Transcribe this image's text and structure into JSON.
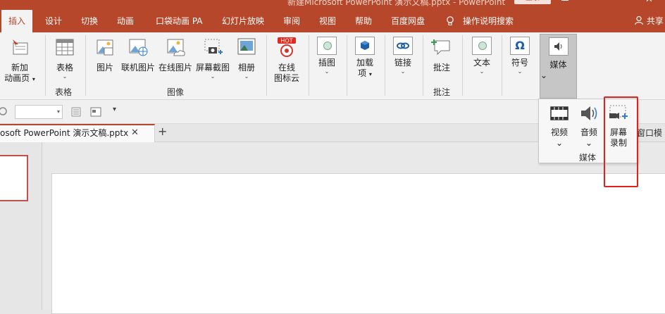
{
  "window": {
    "title": "新建Microsoft PowerPoint 演示文稿.pptx - PowerPoint",
    "login_label": "登录",
    "close_glyph": "✕"
  },
  "tabs": [
    {
      "label": "插入",
      "active": true
    },
    {
      "label": "设计"
    },
    {
      "label": "切换"
    },
    {
      "label": "动画"
    },
    {
      "label": "口袋动画 PA"
    },
    {
      "label": "幻灯片放映"
    },
    {
      "label": "审阅"
    },
    {
      "label": "视图"
    },
    {
      "label": "帮助"
    },
    {
      "label": "百度网盘"
    },
    {
      "label": "操作说明搜索"
    }
  ],
  "share_label": "共享",
  "ribbon": {
    "new_anim_page": {
      "line1": "新加",
      "line2": "动画页"
    },
    "table": {
      "label": "表格",
      "group": "表格"
    },
    "images": {
      "picture": "图片",
      "online_picture": "联机图片",
      "web_picture": "在线图片",
      "screenshot": "屏幕截图",
      "album": "相册",
      "group": "图像"
    },
    "icon_cloud": {
      "badge": "HOT",
      "line1": "在线",
      "line2": "图标云"
    },
    "illustrations": "插图",
    "addins": {
      "line1": "加载",
      "line2": "项"
    },
    "links": "链接",
    "comment": {
      "label": "批注",
      "group": "批注"
    },
    "text": "文本",
    "symbols": "符号",
    "media": "媒体",
    "caret": "⌄"
  },
  "document": {
    "tab_name": "osoft PowerPoint 演示文稿.pptx",
    "tab_close": "✕",
    "new_tab": "+",
    "side_hint": "窗口模"
  },
  "media_dropdown": {
    "video": "视频",
    "audio": "音频",
    "screen_record": {
      "line1": "屏幕",
      "line2": "录制"
    },
    "group": "媒体",
    "caret": "⌄"
  },
  "colors": {
    "accent": "#b7472a",
    "highlight_box": "#e0221f"
  }
}
